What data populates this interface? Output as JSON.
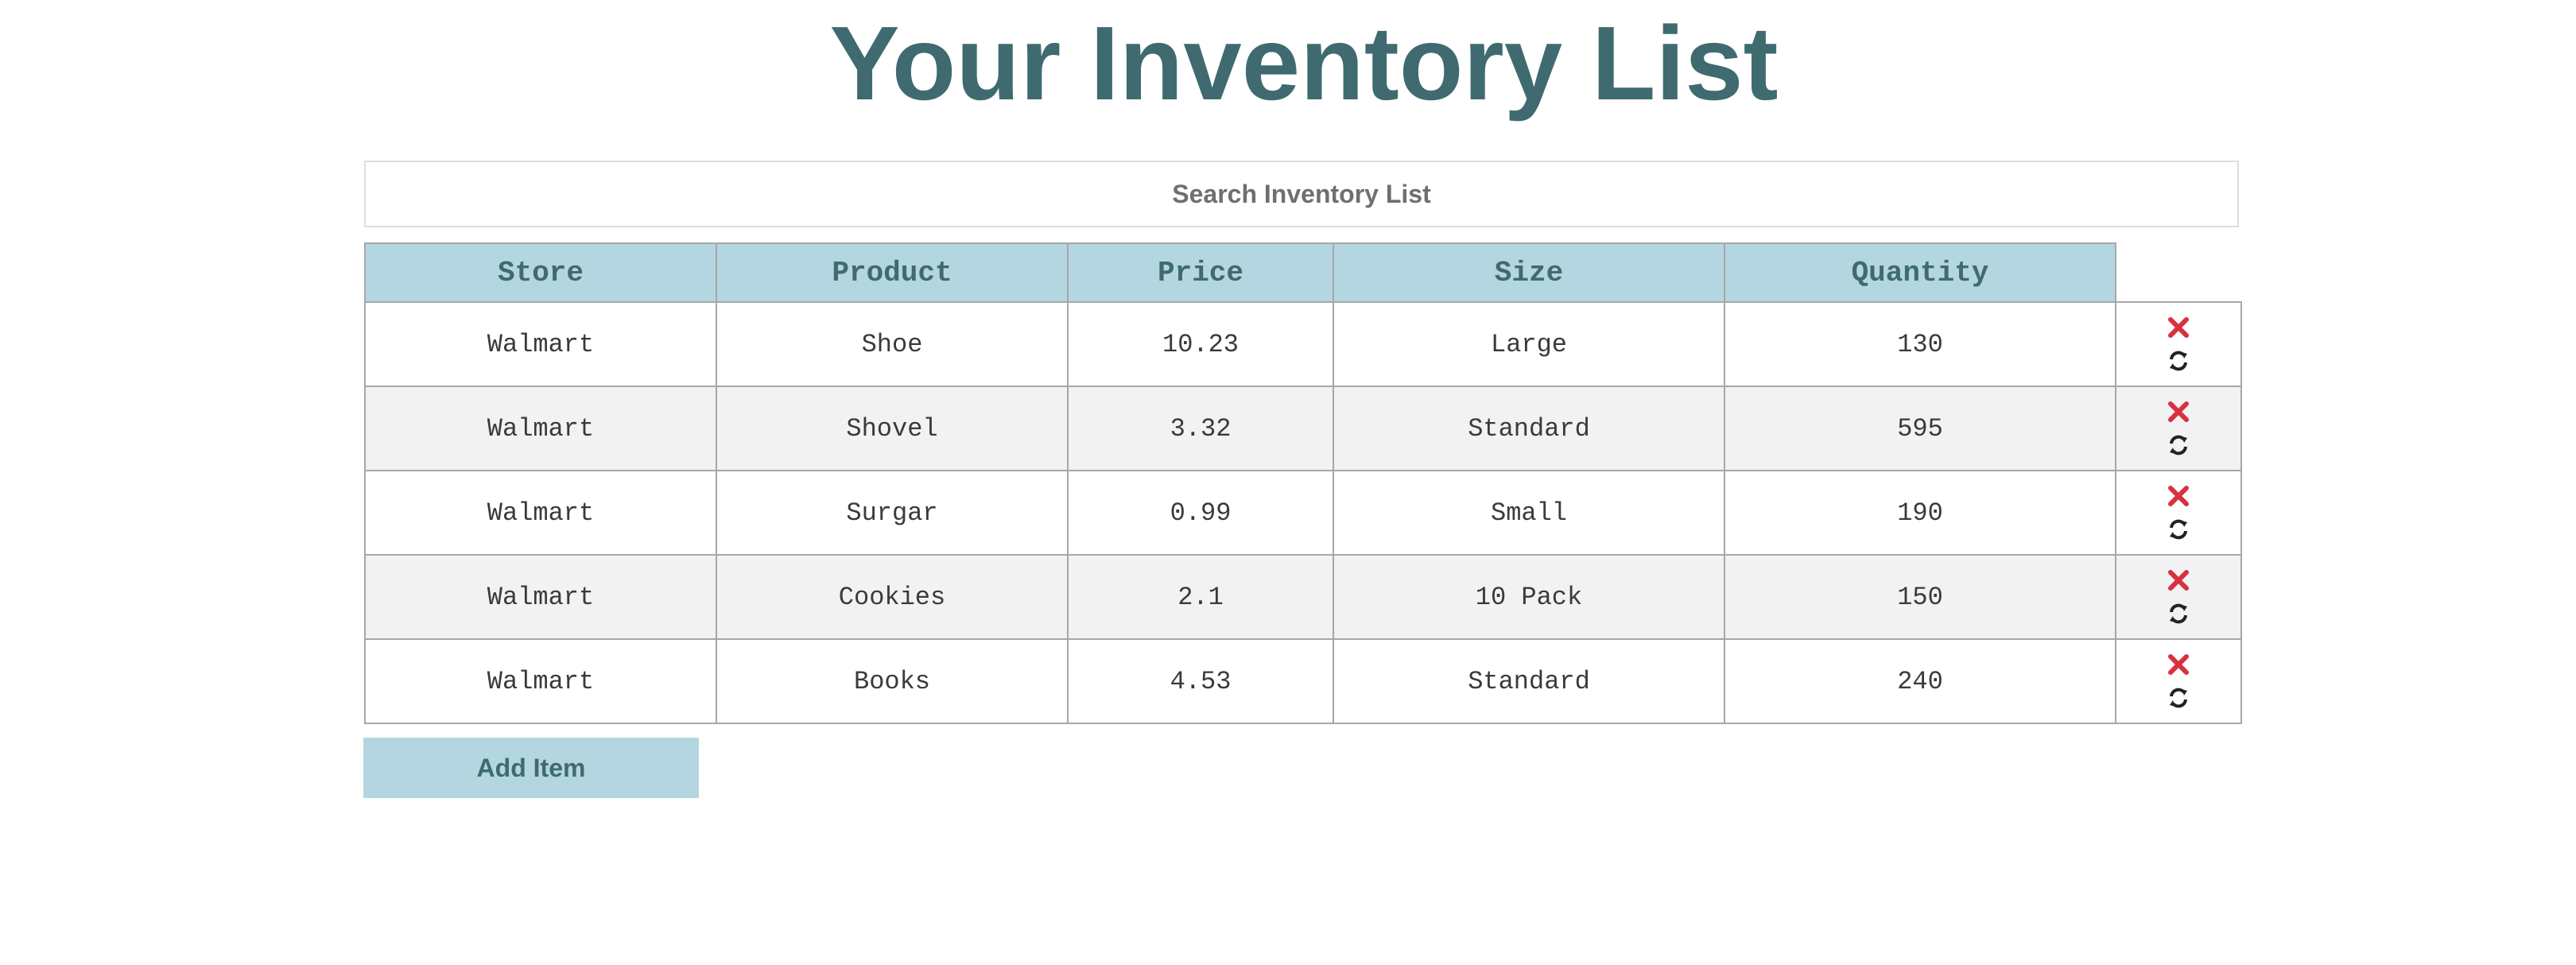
{
  "page": {
    "title": "Your Inventory List"
  },
  "search": {
    "placeholder": "Search Inventory List",
    "value": ""
  },
  "table": {
    "headers": [
      "Store",
      "Product",
      "Price",
      "Size",
      "Quantity"
    ],
    "rows": [
      [
        "Walmart",
        "Shoe",
        "10.23",
        "Large",
        "130"
      ],
      [
        "Walmart",
        "Shovel",
        "3.32",
        "Standard",
        "595"
      ],
      [
        "Walmart",
        "Surgar",
        "0.99",
        "Small",
        "190"
      ],
      [
        "Walmart",
        "Cookies",
        "2.1",
        "10 Pack",
        "150"
      ],
      [
        "Walmart",
        "Books",
        "4.53",
        "Standard",
        "240"
      ]
    ],
    "row_actions": [
      {
        "icon": "delete-icon",
        "color": "#d9303e"
      },
      {
        "icon": "refresh-icon",
        "color": "#222222"
      }
    ]
  },
  "add_button": {
    "label": "Add Item"
  },
  "colors": {
    "accent": "#3f6b70",
    "header_bg": "#b3d6e0",
    "delete": "#d9303e"
  }
}
